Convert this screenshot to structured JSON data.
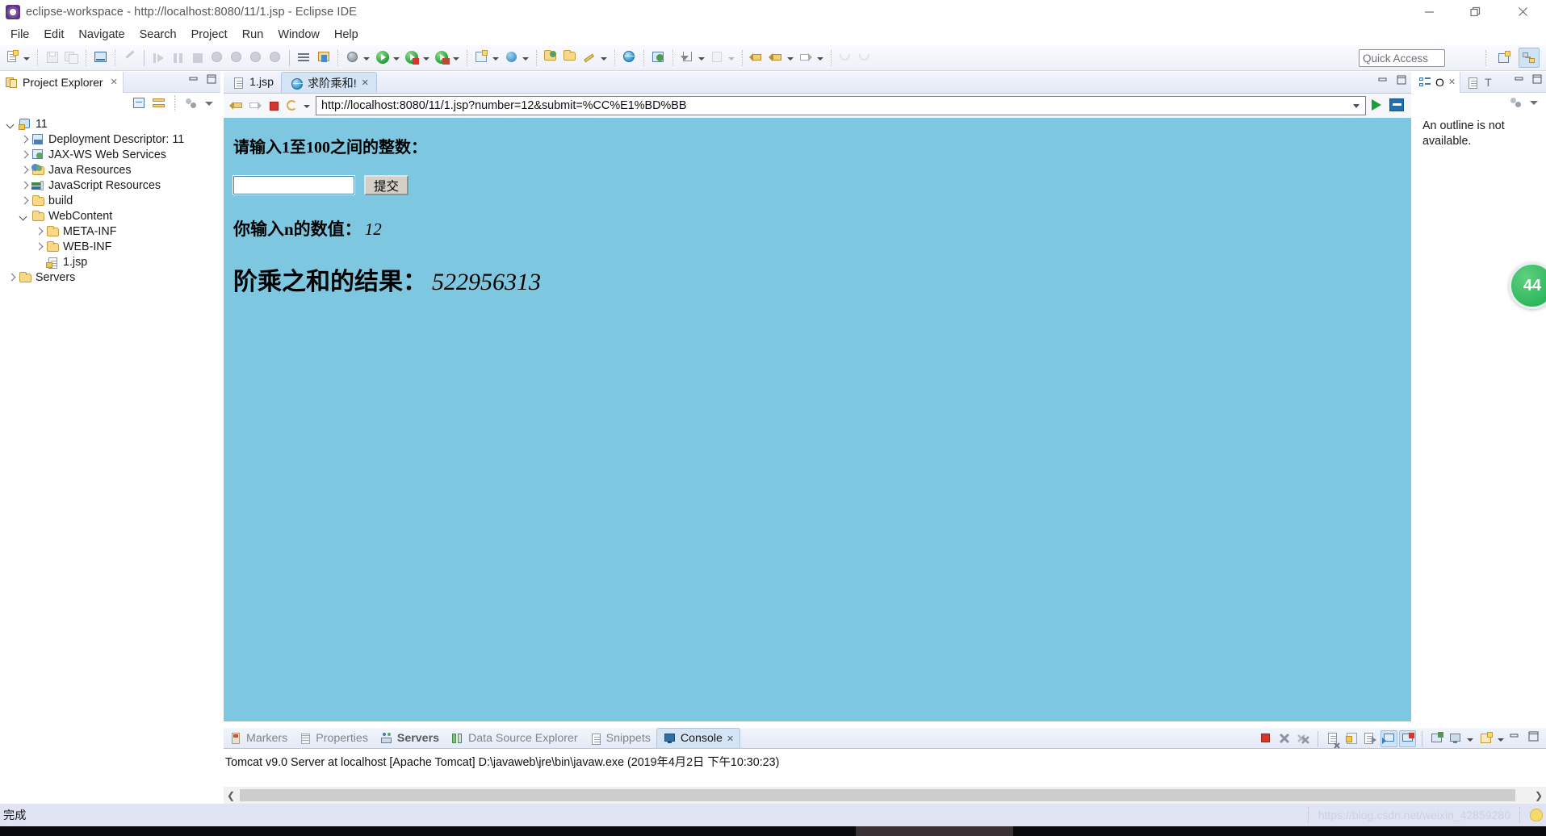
{
  "window": {
    "title": "eclipse-workspace - http://localhost:8080/11/1.jsp - Eclipse IDE",
    "app_icon": "eclipse-icon",
    "controls": {
      "minimize": "minimize-icon",
      "maximize": "maximize-icon",
      "close": "close-icon"
    }
  },
  "menubar": {
    "items": [
      {
        "label": "File"
      },
      {
        "label": "Edit"
      },
      {
        "label": "Navigate"
      },
      {
        "label": "Search"
      },
      {
        "label": "Project"
      },
      {
        "label": "Run"
      },
      {
        "label": "Window"
      },
      {
        "label": "Help"
      }
    ]
  },
  "toolbar": {
    "quick_access_placeholder": "Quick Access",
    "icons": [
      "new-wizard-icon",
      "save-icon",
      "save-all-icon",
      "new-java-class-icon",
      "link-broken-icon",
      "resume-icon",
      "suspend-icon",
      "terminate-icon",
      "step-into-icon",
      "step-over-icon",
      "step-return-icon",
      "drop-to-frame-icon",
      "skip-breakpoints-icon",
      "open-type-icon",
      "debug-icon",
      "run-icon",
      "run-as-server-icon",
      "profile-icon",
      "new-server-icon",
      "search-icon",
      "open-resource-icon",
      "pin-icon",
      "globe-browser-icon",
      "web-service-icon",
      "previous-annotation-icon",
      "next-annotation-icon",
      "back-icon",
      "forward-icon"
    ],
    "perspective_buttons": [
      "open-perspective-icon",
      "java-ee-perspective-icon"
    ]
  },
  "project_explorer": {
    "title": "Project Explorer",
    "close_glyph": "✕",
    "toolbar_icons": [
      "collapse-all-icon",
      "link-with-editor-icon",
      "view-menu-icon",
      "view-dropdown-icon"
    ],
    "tree": [
      {
        "label": "11",
        "icon": "project-warning-icon",
        "depth": 0,
        "state": "expanded"
      },
      {
        "label": "Deployment Descriptor: 11",
        "icon": "deployment-descriptor-icon",
        "depth": 1,
        "state": "collapsed"
      },
      {
        "label": "JAX-WS Web Services",
        "icon": "web-service-icon",
        "depth": 1,
        "state": "collapsed"
      },
      {
        "label": "Java Resources",
        "icon": "java-resources-icon",
        "depth": 1,
        "state": "collapsed"
      },
      {
        "label": "JavaScript Resources",
        "icon": "javascript-resources-icon",
        "depth": 1,
        "state": "collapsed"
      },
      {
        "label": "build",
        "icon": "folder-icon",
        "depth": 1,
        "state": "collapsed"
      },
      {
        "label": "WebContent",
        "icon": "folder-icon",
        "depth": 1,
        "state": "expanded"
      },
      {
        "label": "META-INF",
        "icon": "folder-icon",
        "depth": 2,
        "state": "collapsed"
      },
      {
        "label": "WEB-INF",
        "icon": "folder-icon",
        "depth": 2,
        "state": "collapsed"
      },
      {
        "label": "1.jsp",
        "icon": "jsp-file-icon",
        "depth": 2,
        "state": "leaf"
      },
      {
        "label": "Servers",
        "icon": "folder-icon",
        "depth": 0,
        "state": "collapsed"
      }
    ]
  },
  "editor": {
    "tabs": [
      {
        "label": "1.jsp",
        "icon": "jsp-file-icon",
        "active": false,
        "closable": false
      },
      {
        "label": "求阶乘和!",
        "icon": "globe-icon",
        "active": true,
        "closable": true,
        "close_glyph": "✕"
      }
    ],
    "browser_toolbar": {
      "back_icon": "back-arrow-icon",
      "forward_icon": "forward-arrow-icon",
      "stop_icon": "stop-icon",
      "refresh_icon": "refresh-icon",
      "dropdown_icon": "chevron-down-icon",
      "url": "http://localhost:8080/11/1.jsp?number=12&submit=%CC%E1%BD%BB",
      "go_icon": "go-play-icon",
      "open-external_icon": "open-external-icon"
    },
    "page": {
      "background_color": "#7ec7e0",
      "prompt": "请输入1至100之间的整数：",
      "input_value": "",
      "submit_label": "提交",
      "result_label_1": "你输入n的数值：",
      "result_value_1": "12",
      "result_label_2": "阶乘之和的结果：",
      "result_value_2": "522956313"
    }
  },
  "outline": {
    "tabs": [
      {
        "label": "",
        "icon": "outline-tree-icon"
      },
      {
        "label": "",
        "icon": "outline-circle-icon"
      }
    ],
    "close_glyph": "✕",
    "secondary_icons": [
      "properties-icon",
      "text-t-icon"
    ],
    "toolbar_icons": [
      "view-menu-icon",
      "view-dropdown-icon"
    ],
    "message": "An outline is not available."
  },
  "bottom_panel": {
    "tabs": [
      {
        "label": "Markers",
        "icon": "markers-icon",
        "active": false,
        "bold": false
      },
      {
        "label": "Properties",
        "icon": "properties-icon",
        "active": false,
        "bold": false
      },
      {
        "label": "Servers",
        "icon": "servers-icon",
        "active": false,
        "bold": true
      },
      {
        "label": "Data Source Explorer",
        "icon": "data-source-icon",
        "active": false,
        "bold": false
      },
      {
        "label": "Snippets",
        "icon": "snippets-icon",
        "active": false,
        "bold": false
      },
      {
        "label": "Console",
        "icon": "console-icon",
        "active": true,
        "bold": false,
        "close_glyph": "✕"
      }
    ],
    "toolbar_icons": [
      "terminate-icon",
      "remove-launch-icon",
      "remove-all-launches-icon",
      "clear-console-icon",
      "scroll-lock-icon",
      "word-wrap-icon",
      "show-console-on-output-icon",
      "show-console-on-error-icon",
      "pin-console-icon",
      "display-selected-console-icon",
      "console-dropdown-icon",
      "open-console-icon",
      "open-console-dropdown-icon",
      "minimize-icon",
      "maximize-icon"
    ],
    "console_output": "Tomcat v9.0 Server at localhost [Apache Tomcat] D:\\javaweb\\jre\\bin\\javaw.exe (2019年4月2日 下午10:30:23)"
  },
  "statusbar": {
    "message": "完成",
    "watermark": "https://blog.csdn.net/weixin_42859280",
    "bulb_icon": "lightbulb-icon"
  },
  "float_badge": {
    "label": "44",
    "color": "#2eb85c"
  }
}
